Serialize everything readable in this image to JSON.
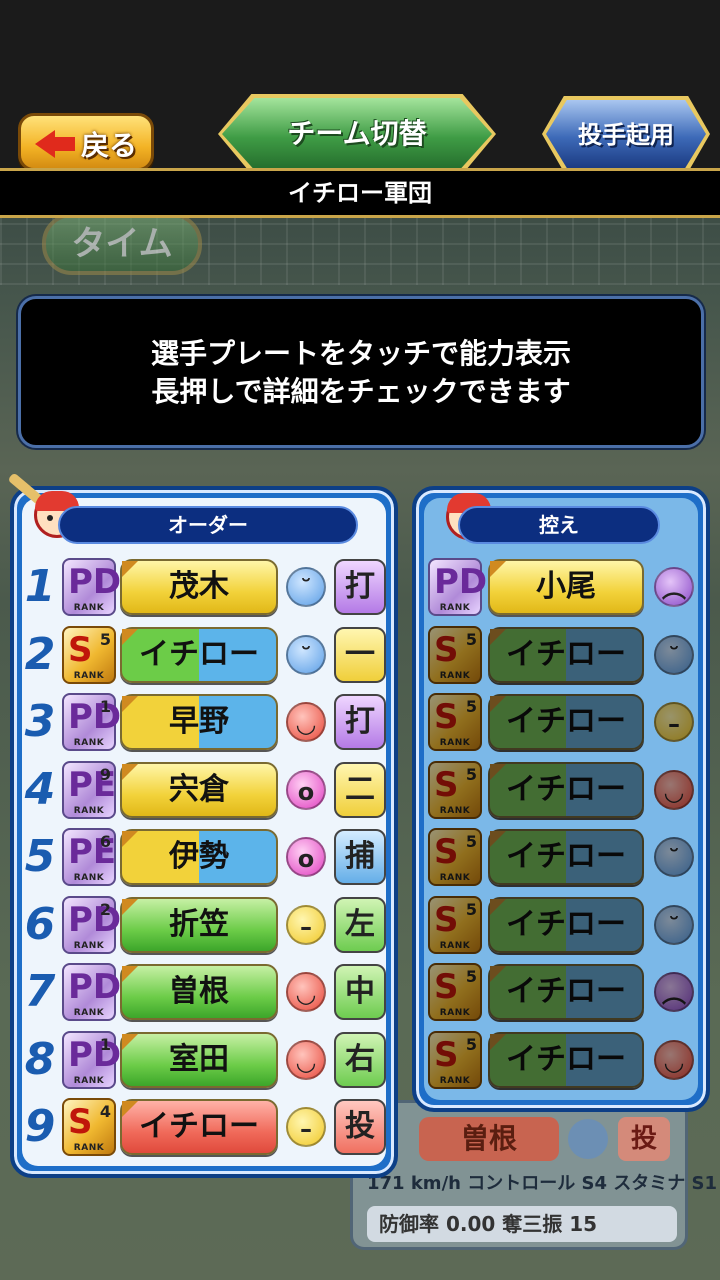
{
  "header": {
    "back_label": "戻る",
    "switch_label": "チーム切替",
    "pitcher_label": "投手起用",
    "team_name": "イチロー軍団"
  },
  "background": {
    "time_label": "タイム",
    "ghost_name": "曽根",
    "ghost_pos": "投",
    "ghost_stats": "171 km/h コントロール S4 スタミナ S1",
    "ghost_era": "防御率 0.00  奪三振  15"
  },
  "message": {
    "line1": "選手プレートをタッチで能力表示",
    "line2": "長押しで詳細をチェックできます"
  },
  "order": {
    "title": "オーダー",
    "rows": [
      {
        "num": "1",
        "rank": "PD",
        "rank_sub": "",
        "name": "茂木",
        "color": "yellow",
        "face": "blue",
        "face_glyph": "˘",
        "pos": "打",
        "pos_color": "purple"
      },
      {
        "num": "2",
        "rank": "S",
        "rank_sub": "5",
        "name": "イチロー",
        "color": "green-blue",
        "face": "blue",
        "face_glyph": "˘",
        "pos": "一",
        "pos_color": "yellow"
      },
      {
        "num": "3",
        "rank": "PD",
        "rank_sub": "1",
        "name": "早野",
        "color": "yellow-blue",
        "face": "red",
        "face_glyph": "◡",
        "pos": "打",
        "pos_color": "purple"
      },
      {
        "num": "4",
        "rank": "PE",
        "rank_sub": "9",
        "name": "宍倉",
        "color": "yellow",
        "face": "pink",
        "face_glyph": "o",
        "pos": "二",
        "pos_color": "yellow"
      },
      {
        "num": "5",
        "rank": "PE",
        "rank_sub": "6",
        "name": "伊勢",
        "color": "yellow-blue",
        "face": "pink",
        "face_glyph": "o",
        "pos": "捕",
        "pos_color": "blue"
      },
      {
        "num": "6",
        "rank": "PD",
        "rank_sub": "2",
        "name": "折笠",
        "color": "green",
        "face": "yellow",
        "face_glyph": "–",
        "pos": "左",
        "pos_color": "green"
      },
      {
        "num": "7",
        "rank": "PD",
        "rank_sub": "",
        "name": "曽根",
        "color": "green",
        "face": "red",
        "face_glyph": "◡",
        "pos": "中",
        "pos_color": "green"
      },
      {
        "num": "8",
        "rank": "PD",
        "rank_sub": "1",
        "name": "室田",
        "color": "green",
        "face": "red",
        "face_glyph": "◡",
        "pos": "右",
        "pos_color": "green"
      },
      {
        "num": "9",
        "rank": "S",
        "rank_sub": "4",
        "name": "イチロー",
        "color": "red",
        "face": "yellow",
        "face_glyph": "–",
        "pos": "投",
        "pos_color": "red"
      }
    ]
  },
  "bench": {
    "title": "控え",
    "rows": [
      {
        "rank": "PD",
        "rank_sub": "",
        "name": "小尾",
        "color": "yellow",
        "face": "purple",
        "face_glyph": "︵",
        "dim": false
      },
      {
        "rank": "S",
        "rank_sub": "5",
        "name": "イチロー",
        "color": "green-blue",
        "face": "blue",
        "face_glyph": "˘",
        "dim": true
      },
      {
        "rank": "S",
        "rank_sub": "5",
        "name": "イチロー",
        "color": "green-blue",
        "face": "yellow",
        "face_glyph": "–",
        "dim": true
      },
      {
        "rank": "S",
        "rank_sub": "5",
        "name": "イチロー",
        "color": "green-blue",
        "face": "red",
        "face_glyph": "◡",
        "dim": true
      },
      {
        "rank": "S",
        "rank_sub": "5",
        "name": "イチロー",
        "color": "green-blue",
        "face": "blue",
        "face_glyph": "˘",
        "dim": true
      },
      {
        "rank": "S",
        "rank_sub": "5",
        "name": "イチロー",
        "color": "green-blue",
        "face": "blue",
        "face_glyph": "˘",
        "dim": true
      },
      {
        "rank": "S",
        "rank_sub": "5",
        "name": "イチロー",
        "color": "green-blue",
        "face": "purple",
        "face_glyph": "︵",
        "dim": true
      },
      {
        "rank": "S",
        "rank_sub": "5",
        "name": "イチロー",
        "color": "green-blue",
        "face": "red",
        "face_glyph": "◡",
        "dim": true
      }
    ]
  }
}
